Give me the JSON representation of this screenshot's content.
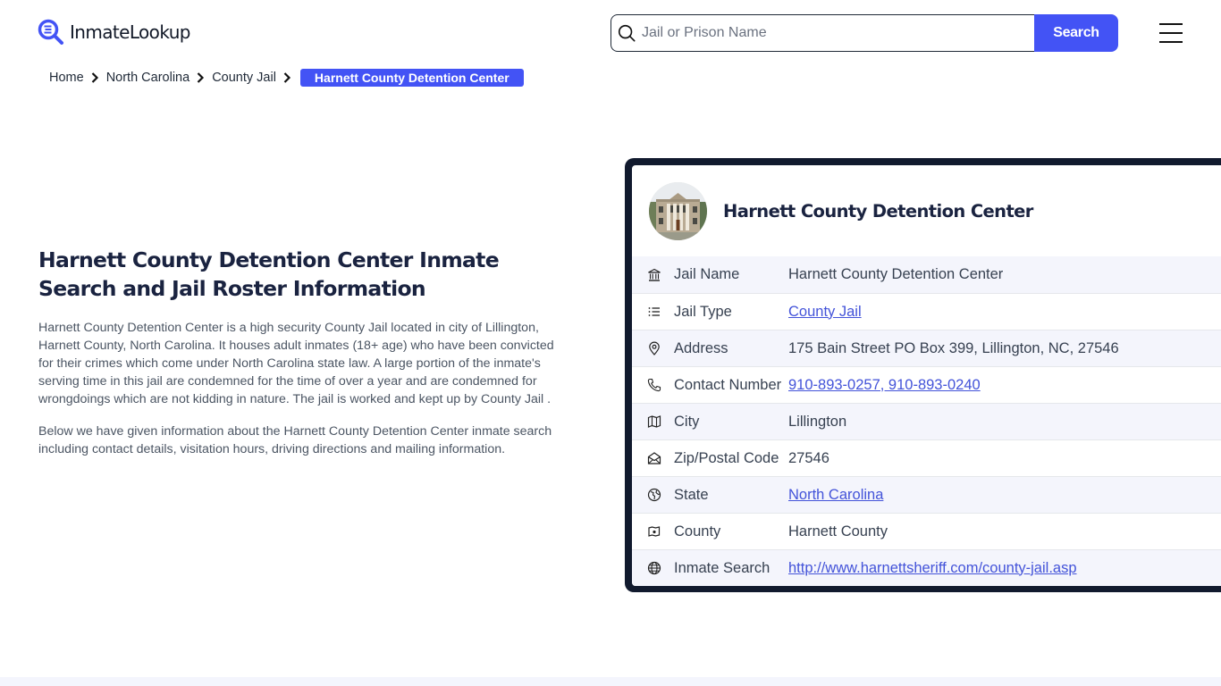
{
  "header": {
    "logo_text": "InmateLookup",
    "search": {
      "placeholder": "Jail or Prison Name",
      "value": "",
      "button_label": "Search"
    },
    "menu_icon": "hamburger-menu-icon"
  },
  "breadcrumb": {
    "items": [
      "Home",
      "North Carolina",
      "County Jail"
    ],
    "current": "Harnett County Detention Center"
  },
  "intro": {
    "title": "Harnett County Detention Center Inmate Search and Jail Roster Information",
    "paragraphs": [
      "Harnett County Detention Center is a high security County Jail located in city of Lillington, Harnett County, North Carolina. It houses adult inmates (18+ age) who have been convicted for their crimes which come under North Carolina state law. A large portion of the inmate's serving time in this jail are condemned for the time of over a year and are condemned for wrongdoings which are not kidding in nature. The jail is worked and kept up by County Jail .",
      "Below we have given information about the Harnett County Detention Center inmate search including contact details, visitation hours, driving directions and mailing information."
    ]
  },
  "card": {
    "title": "Harnett County Detention Center",
    "photo": "jail-building-photo",
    "rows": [
      {
        "icon": "building-columns-icon",
        "label": "Jail Name",
        "value": "Harnett County Detention Center",
        "link": false
      },
      {
        "icon": "list-icon",
        "label": "Jail Type",
        "value": "County Jail",
        "link": true
      },
      {
        "icon": "map-pin-icon",
        "label": "Address",
        "value": "175 Bain Street PO Box 399, Lillington, NC, 27546",
        "link": false
      },
      {
        "icon": "phone-icon",
        "label": "Contact Number",
        "value": "910-893-0257, 910-893-0240",
        "link": true
      },
      {
        "icon": "map-icon",
        "label": "City",
        "value": "Lillington",
        "link": false
      },
      {
        "icon": "mail-open-icon",
        "label": "Zip/Postal Code",
        "value": "27546",
        "link": false
      },
      {
        "icon": "state-globe-icon",
        "label": "State",
        "value": "North Carolina",
        "link": true
      },
      {
        "icon": "county-map-icon",
        "label": "County",
        "value": "Harnett County",
        "link": false
      },
      {
        "icon": "world-icon",
        "label": "Inmate Search",
        "value": "http://www.harnettsheriff.com/county-jail.asp",
        "link": true
      }
    ]
  },
  "colors": {
    "accent": "#4353f5",
    "heading": "#1a2340",
    "card_frame": "#111a2e",
    "row_alt": "#f4f5fc",
    "link": "#4353d9"
  }
}
